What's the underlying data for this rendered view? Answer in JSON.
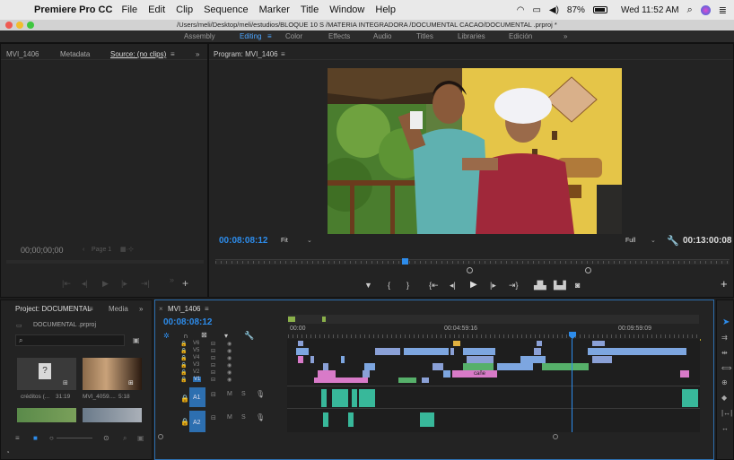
{
  "os_menu": {
    "app_name": "Premiere Pro CC",
    "items": [
      "File",
      "Edit",
      "Clip",
      "Sequence",
      "Marker",
      "Title",
      "Window",
      "Help"
    ],
    "battery": "87%",
    "clock": "Wed 11:52 AM"
  },
  "window": {
    "path": "/Users/meli/Desktop/meli/estudios/BLOQUE 10 S /MATERIA INTEGRADORA /DOCUMENTAL CACAO/DOCUMENTAL .prproj *"
  },
  "workspaces": {
    "items": [
      "Assembly",
      "Editing",
      "Color",
      "Effects",
      "Audio",
      "Titles",
      "Libraries",
      "Edición"
    ],
    "active": "Editing",
    "more": "»"
  },
  "source_panel": {
    "clip_tab": "MVI_1406",
    "metadata_tab": "Metadata",
    "source_tab": "Source: (no clips)",
    "menu": "≡",
    "more": "»",
    "timecode": "00;00;00;00",
    "page": "Page 1"
  },
  "program_panel": {
    "title": "Program: MVI_1406",
    "menu": "≡",
    "timecode": "00:08:08:12",
    "fit": "Fit",
    "quality": "Full",
    "duration": "00:13:00:08"
  },
  "project_panel": {
    "tab": "Project: DOCUMENTAL",
    "menu": "≡",
    "media_tab": "Media",
    "more": "»",
    "file": "DOCUMENTAL .prproj",
    "items": [
      {
        "name": "créditos (...",
        "duration": "31:19"
      },
      {
        "name": "MVI_4059....",
        "duration": "5:18"
      }
    ]
  },
  "timeline": {
    "tab": "MVI_1406",
    "menu": "≡",
    "timecode": "00:08:08:12",
    "ruler": [
      "00:00",
      "00:04:59:16",
      "00:09:59:09"
    ],
    "video_tracks": [
      "V6",
      "V5",
      "V4",
      "V3",
      "V2",
      "V1"
    ],
    "audio_tracks": [
      "A1",
      "A2"
    ],
    "track_controls": [
      "M",
      "S"
    ],
    "clip_label": "cañe"
  },
  "colors": {
    "accent": "#2d8ceb",
    "bg": "#1d1d1d",
    "panel": "#232323",
    "video_clip": "#8aa0d6",
    "audio_clip": "#38b89a",
    "pink_clip": "#d87ac8",
    "green_clip": "#56b06a"
  }
}
